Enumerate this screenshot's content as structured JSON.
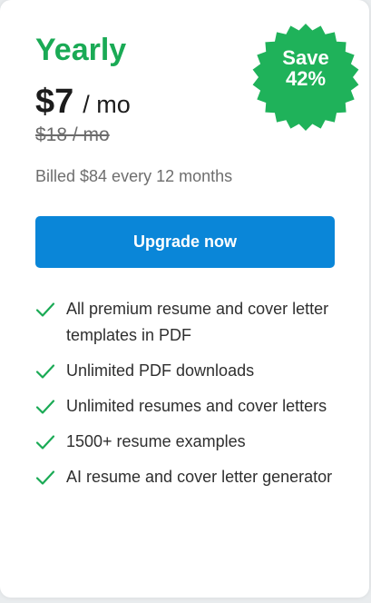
{
  "plan": {
    "name": "Yearly",
    "price": "$7",
    "period": "/ mo",
    "old_price": "$18 / mo",
    "billing": "Billed $84 every 12 months",
    "cta_label": "Upgrade now"
  },
  "badge": {
    "line1": "Save",
    "line2": "42%"
  },
  "features": [
    "All premium resume and cover letter templates in PDF",
    "Unlimited PDF downloads",
    "Unlimited resumes and cover letters",
    "1500+ resume examples",
    "AI resume and cover letter generator"
  ],
  "colors": {
    "accent_green": "#1aaa55",
    "badge_green": "#1fb25a",
    "button_blue": "#0a86d8",
    "check_green": "#1aaa55"
  },
  "icons": {
    "feature_check": "check-icon",
    "badge_shape": "starburst-badge"
  }
}
